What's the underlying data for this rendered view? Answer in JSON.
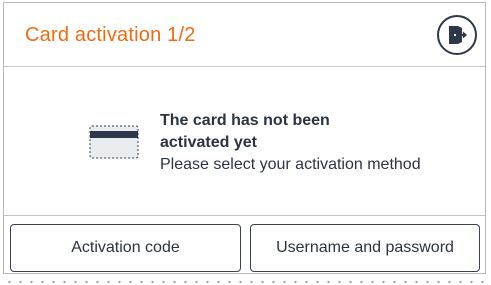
{
  "header": {
    "title": "Card activation 1/2",
    "exit_icon": "exit-door-icon"
  },
  "message": {
    "title": "The card has not been activated yet",
    "subtitle": "Please select your activation method",
    "card_icon": "credit-card-icon"
  },
  "actions": {
    "activation_code_label": "Activation code",
    "username_password_label": "Username and password"
  },
  "colors": {
    "accent": "#f06a12",
    "text": "#2c3340",
    "border": "#c4c4c4"
  }
}
